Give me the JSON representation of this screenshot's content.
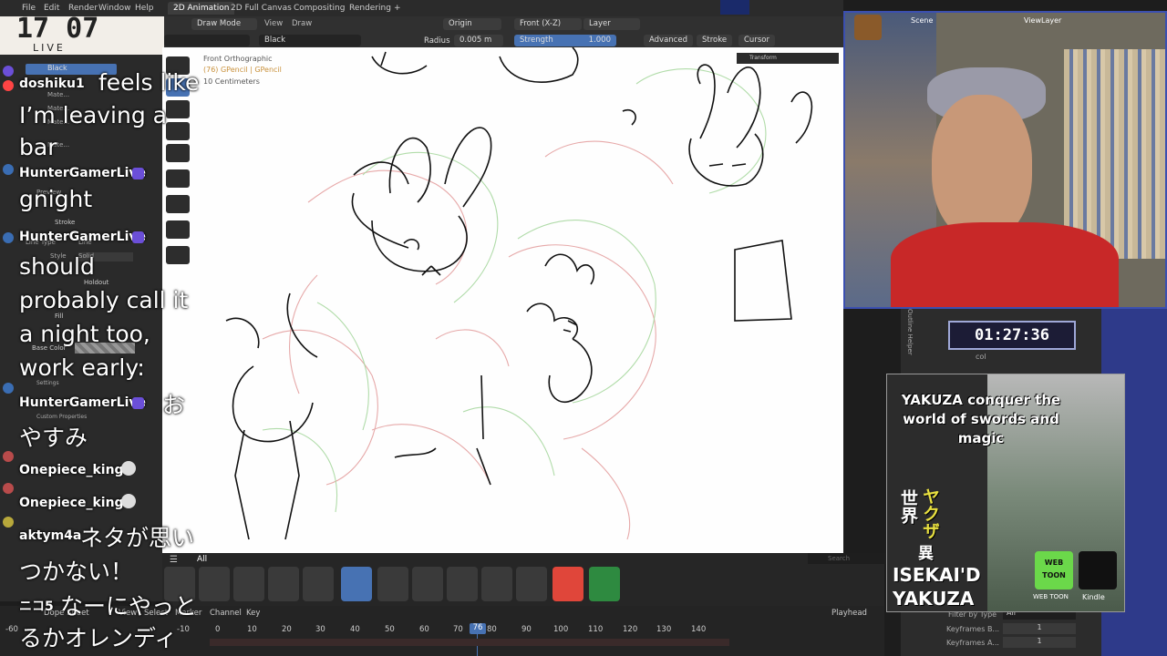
{
  "clock": {
    "time": "17 07",
    "live": "LIVE"
  },
  "topbar": {
    "menus": [
      "File",
      "Edit",
      "Render",
      "Window",
      "Help"
    ],
    "workspaces": [
      "2D Animation",
      "2D Full Canvas",
      "Compositing",
      "Rendering",
      "+"
    ],
    "scene": "Scene",
    "view_layer": "ViewLayer"
  },
  "header": {
    "mode": "Draw Mode",
    "view": "View",
    "draw": "Draw",
    "origin": "Origin",
    "front": "Front (X-Z)",
    "layer": "Layer",
    "material": "Black",
    "radius_label": "Radius",
    "radius_value": "0.005 m",
    "strength_label": "Strength",
    "strength_value": "1.000",
    "advanced": "Advanced",
    "stroke": "Stroke",
    "cursor": "Cursor",
    "transform": "Transform"
  },
  "viewport": {
    "view_name": "Front Orthographic",
    "object_info": "(76) GPencil | GPencil",
    "scale": "10 Centimeters"
  },
  "leftpanel": {
    "material_black": "Black",
    "mate_items": [
      "Mate...",
      "Mate...",
      "Mate...",
      "Mate..."
    ],
    "preview": "Preview",
    "stroke": "Stroke",
    "line_type_label": "Line Type",
    "line_type": "Line",
    "style_label": "Style",
    "style": "Solid",
    "holdout": "Holdout",
    "fill": "Fill",
    "base_color": "Base Color",
    "settings": "Settings",
    "custom_props": "Custom Properties"
  },
  "chat": [
    {
      "user": "doshiku1",
      "text": "feels like I’m leaving a bar"
    },
    {
      "user": "HunterGamerLive",
      "text": "gnight"
    },
    {
      "user": "HunterGamerLive",
      "text": "should probably call it a night too, work early:"
    },
    {
      "user": "HunterGamerLive",
      "text": "おやすみ"
    },
    {
      "user": "Onepiece_king",
      "text": ""
    },
    {
      "user": "Onepiece_king",
      "text": ""
    },
    {
      "user": "aktym4a",
      "text": "ネタが思いつかない！"
    },
    {
      "user": "ニコ5",
      "text": "なーにやっとるかオレンディ"
    }
  ],
  "chat_lines": {
    "l1a": "feels like",
    "l1b": "I’m leaving a",
    "l1c": "bar",
    "l2": "gnight",
    "l3a": "should",
    "l3b": "probably call it",
    "l3c": "a night too,",
    "l3d": "work early:",
    "l4a": "お",
    "l4b": "やすみ",
    "l7a": "ネタが思い",
    "l7b": "つかない！",
    "l8a": "なーにやっと",
    "l8b": "るかオレンディ"
  },
  "brushbar": {
    "tab_all": "All",
    "search_placeholder": "Search"
  },
  "timeline": {
    "editor": "Dope Sheet",
    "menus": [
      "View",
      "Select",
      "Marker",
      "Channel",
      "Key"
    ],
    "playhead": "Playhead",
    "current_frame": "76",
    "ticks": [
      "-60",
      "-10",
      "0",
      "10",
      "20",
      "30",
      "40",
      "50",
      "60",
      "70",
      "80",
      "90",
      "100",
      "110",
      "120",
      "130",
      "140"
    ]
  },
  "rightpanel": {
    "timer": "01:27:36",
    "col": "col",
    "outline_helper": "Outline Helper",
    "filter_by_type": "Filter by Type",
    "filter_value": "All",
    "keyframes_before_label": "Keyframes B...",
    "keyframes_before": "1",
    "keyframes_after_label": "Keyframes A...",
    "keyframes_after": "1"
  },
  "bookad": {
    "title": "YAKUZA conquer the world of swords and magic",
    "jp_a": "世界",
    "jp_b": "ヤクザ",
    "jp_c": "異",
    "isekaid": "ISEKAI'D",
    "yakuza": "YAKUZA",
    "webtoon": "WEB TOON",
    "webtoon_caption": "WEB TOON",
    "kindle": "Kindle"
  },
  "colors": {
    "accent": "#4772b3",
    "blender_bg": "#2b2b2b",
    "orange_key": "#e8a33b",
    "chat_badge": "#6b4fd8"
  }
}
